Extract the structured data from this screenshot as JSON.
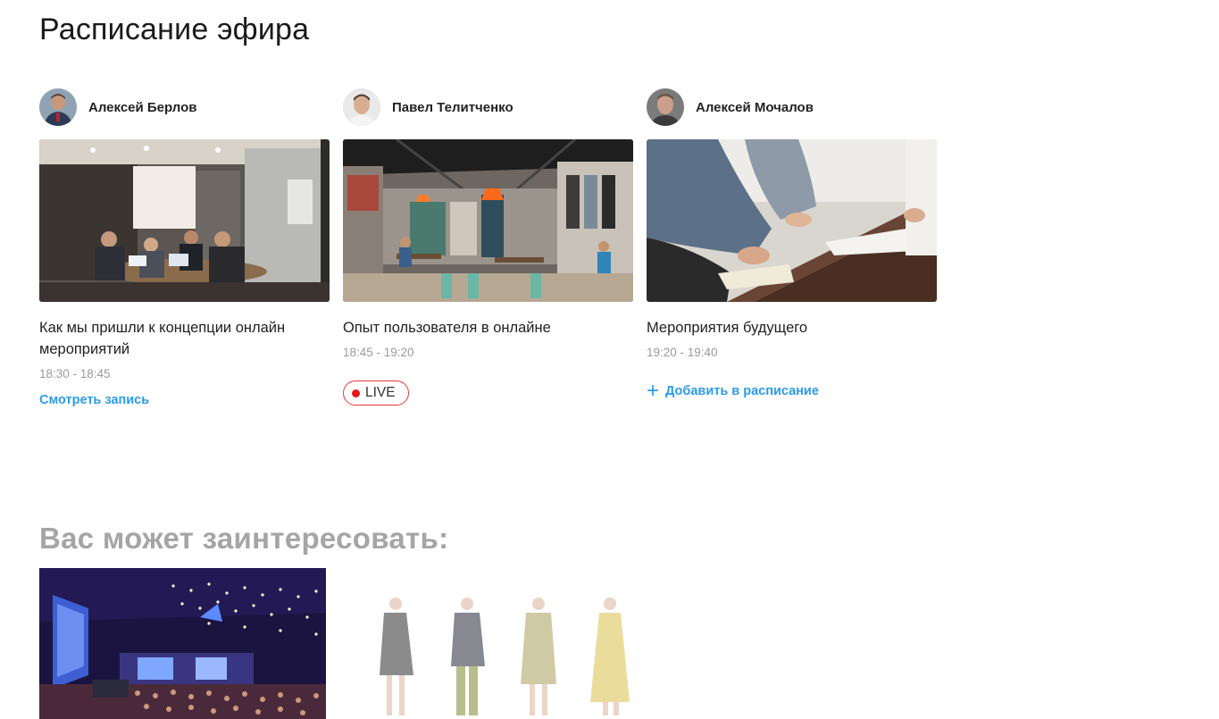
{
  "page_title": "Расписание эфира",
  "schedule": [
    {
      "speaker": "Алексей Берлов",
      "title": "Как мы пришли к концепции онлайн мероприятий",
      "time": "18:30 - 18:45",
      "action": "Смотреть запись",
      "image": "office-meeting-photo"
    },
    {
      "speaker": "Павел Телитченко",
      "title": "Опыт пользователя в онлайне",
      "time": "18:45  - 19:20",
      "action": "LIVE",
      "image": "cafe-store-photo"
    },
    {
      "speaker": "Алексей Мочалов",
      "title": "Мероприятия будущего",
      "time": "19:20 - 19:40",
      "action": "Добавить в расписание",
      "image": "people-writing-photo"
    }
  ],
  "recommendations": {
    "title": "Вас может заинтересовать:",
    "items": [
      {
        "image": "conference-hall-photo"
      },
      {
        "image": "fashion-sketches-image"
      }
    ]
  },
  "colors": {
    "link": "#2b9ce8",
    "live_border": "#e53935",
    "live_dot": "#e01b1b",
    "muted_text": "#9a9a9a",
    "section_title": "#a5a5a5"
  }
}
